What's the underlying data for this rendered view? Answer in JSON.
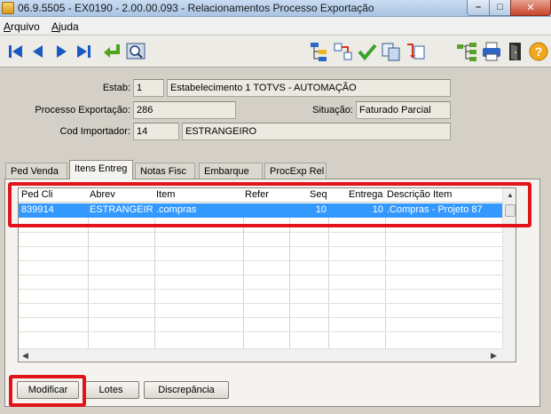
{
  "window": {
    "title": "06.9.5505 - EX0190 - 2.00.00.093 - Relacionamentos Processo Exportação"
  },
  "menu": {
    "items": [
      "Arquivo",
      "Ajuda"
    ]
  },
  "toolbar": {
    "icons": [
      "first-record-icon",
      "prev-record-icon",
      "next-record-icon",
      "last-record-icon",
      "goto-icon",
      "zoom-icon",
      "edit-structure-icon",
      "relate-icon",
      "confirm-icon",
      "copy-icon",
      "transfer-icon",
      "hierarchy-icon",
      "print-icon",
      "exit-icon",
      "help-icon"
    ]
  },
  "header": {
    "estab_label": "Estab:",
    "estab_code": "1",
    "estab_name": "Estabelecimento 1 TOTVS - AUTOMAÇÃO",
    "processo_label": "Processo Exportação:",
    "processo_value": "286",
    "situacao_label": "Situação:",
    "situacao_value": "Faturado Parcial",
    "importador_label": "Cod Importador:",
    "importador_code": "14",
    "importador_name": "ESTRANGEIRO"
  },
  "tabs": [
    {
      "label": "Ped Venda"
    },
    {
      "label": "Itens Entreg"
    },
    {
      "label": "Notas Fisc"
    },
    {
      "label": "Embarque"
    },
    {
      "label": "ProcExp Rel"
    }
  ],
  "grid": {
    "columns": [
      "Ped Cli",
      "Abrev",
      "Item",
      "Refer",
      "Seq",
      "Entrega",
      "Descrição Item"
    ],
    "rows": [
      {
        "ped_cli": "839914",
        "abrev": "ESTRANGEIR",
        "item": ".compras",
        "refer": "",
        "seq": "10",
        "entrega": "10",
        "descricao": ".Compras - Projeto 87"
      }
    ]
  },
  "buttons": {
    "modificar": "Modificar",
    "lotes": "Lotes",
    "discrepancia": "Discrepância"
  },
  "colors": {
    "selection": "#3399ff",
    "highlight": "#e0141a"
  }
}
